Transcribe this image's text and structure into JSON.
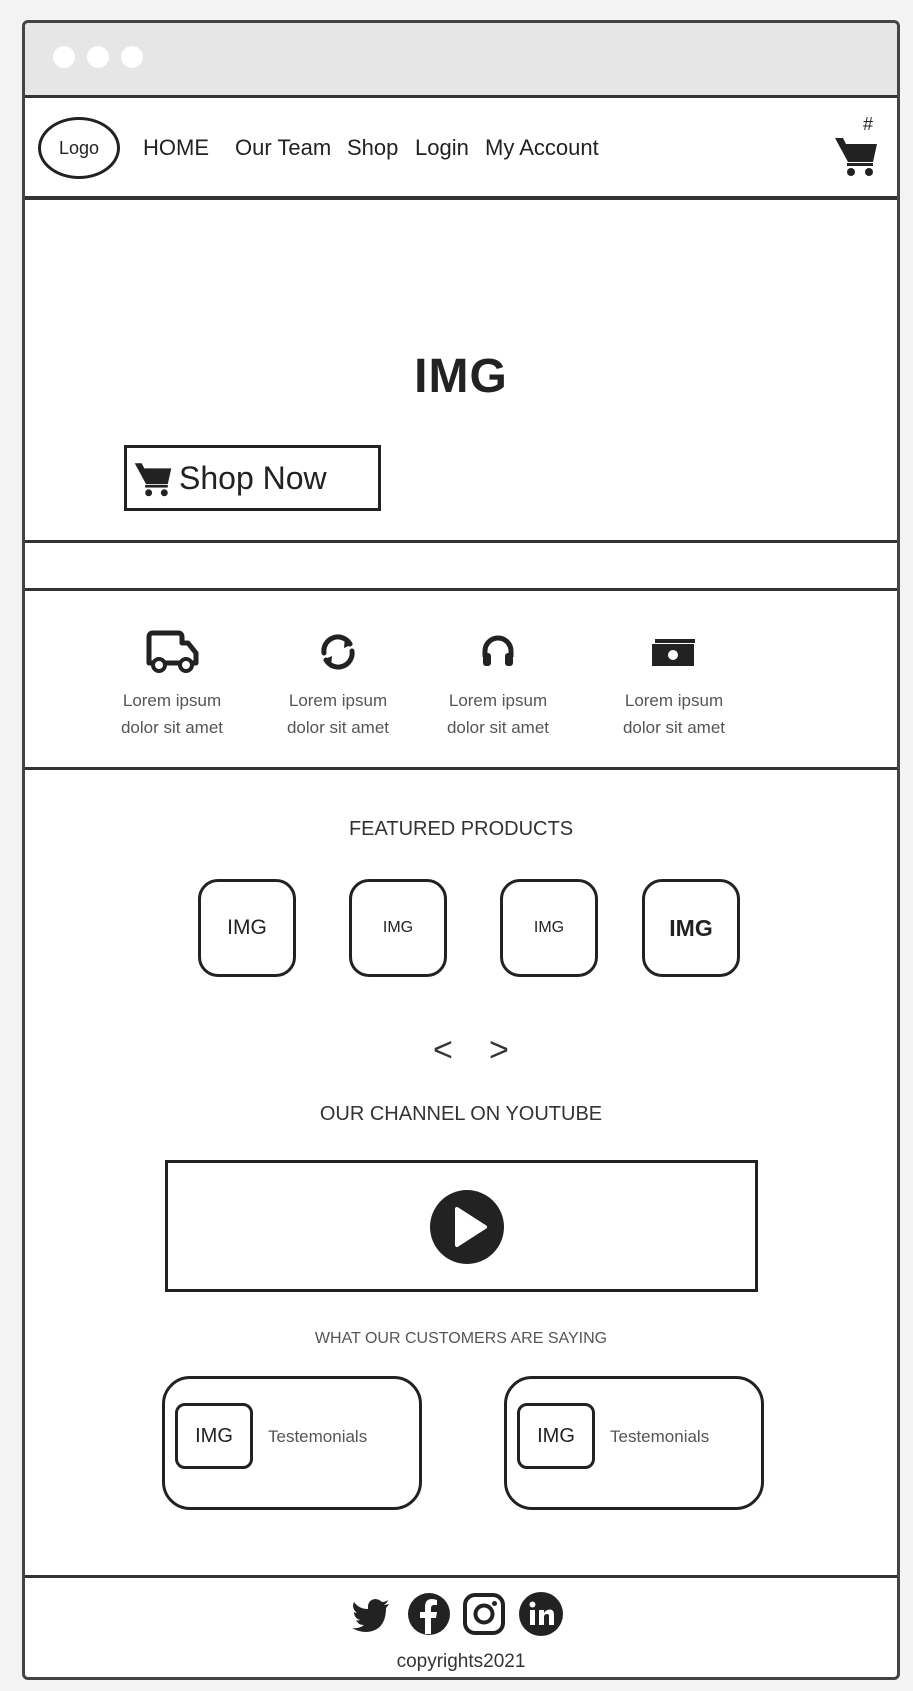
{
  "nav": {
    "logo": "Logo",
    "links": [
      "HOME",
      "Our Team",
      "Shop",
      "Login",
      "My Account"
    ],
    "cart_count": "#"
  },
  "hero": {
    "image_label": "IMG",
    "cta_label": "Shop Now"
  },
  "features": [
    {
      "icon": "delivery-truck-icon",
      "line1": "Lorem ipsum",
      "line2": "dolor sit amet"
    },
    {
      "icon": "refresh-icon",
      "line1": "Lorem ipsum",
      "line2": "dolor sit amet"
    },
    {
      "icon": "headphones-icon",
      "line1": "Lorem ipsum",
      "line2": "dolor sit amet"
    },
    {
      "icon": "money-icon",
      "line1": "Lorem ipsum",
      "line2": "dolor sit amet"
    }
  ],
  "featured": {
    "title": "FEATURED PRODUCTS",
    "products": [
      "IMG",
      "IMG",
      "IMG",
      "IMG"
    ],
    "prev": "<",
    "next": ">"
  },
  "youtube": {
    "title": "OUR CHANNEL ON YOUTUBE"
  },
  "testimonials": {
    "title": "WHAT OUR CUSTOMERS ARE SAYING",
    "items": [
      {
        "img": "IMG",
        "text": "Testemonials"
      },
      {
        "img": "IMG",
        "text": "Testemonials"
      }
    ]
  },
  "footer": {
    "social": [
      "twitter-icon",
      "facebook-icon",
      "instagram-icon",
      "linkedin-icon"
    ],
    "copyright": "copyrights2021"
  },
  "colors": {
    "ink": "#222222",
    "border": "#333333",
    "muted_text": "#555555",
    "titlebar": "#e6e6e6"
  }
}
